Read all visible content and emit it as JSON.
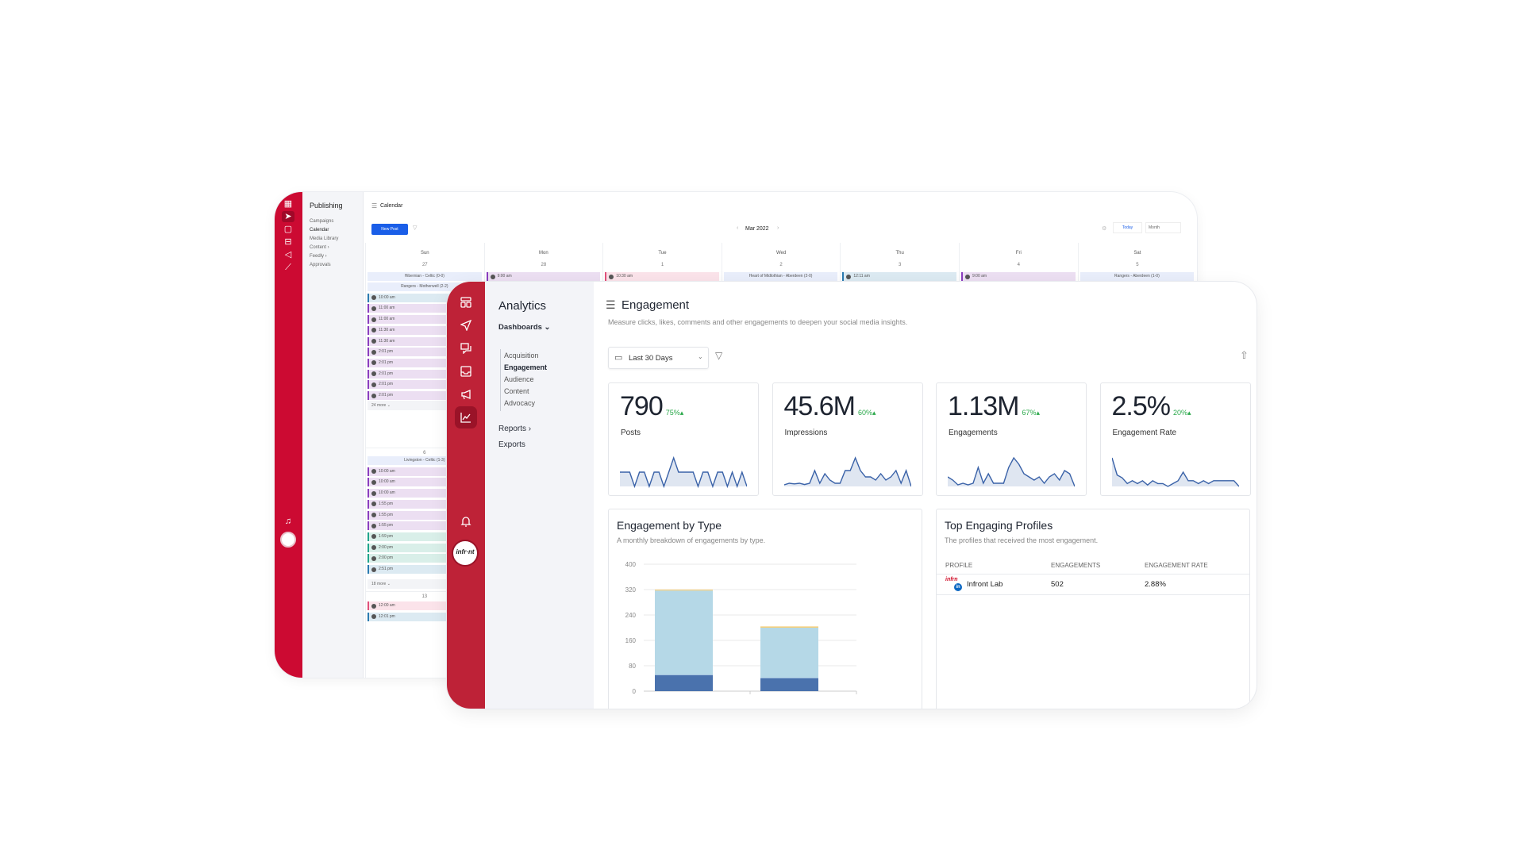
{
  "publishing": {
    "title": "Publishing",
    "items": [
      "Campaigns",
      "Calendar",
      "Media Library",
      "Content ›",
      "Feedly ›",
      "Approvals"
    ],
    "calendar_title": "Calendar",
    "new_post": "New Post",
    "month": "Mar 2022",
    "today": "Today",
    "view": "Month",
    "days": [
      "Sun",
      "Mon",
      "Tue",
      "Wed",
      "Thu",
      "Fri",
      "Sat"
    ],
    "week1_dates": [
      "27",
      "28",
      "1",
      "2",
      "3",
      "4",
      "5"
    ],
    "week1_events": [
      {
        "day": 0,
        "text": "Hibernian - Celtic (0-0)",
        "kind": "g"
      },
      {
        "day": 1,
        "text": "9:00 am",
        "kind": "v"
      },
      {
        "day": 2,
        "text": "10:30 am",
        "kind": "p"
      },
      {
        "day": 3,
        "text": "Heart of Midlothian - Aberdeen (2-0)",
        "kind": "g"
      },
      {
        "day": 4,
        "text": "12:11 am",
        "kind": "b"
      },
      {
        "day": 5,
        "text": "9:00 am",
        "kind": "v"
      },
      {
        "day": 6,
        "text": "Rangers - Aberdeen (1-0)",
        "kind": "g"
      }
    ],
    "sun_events_1": [
      {
        "text": "Rangers - Motherwell (2-2)",
        "kind": "g"
      },
      {
        "text": "10:00 am",
        "kind": "b"
      },
      {
        "text": "11:00 am",
        "kind": "v"
      },
      {
        "text": "11:00 am",
        "kind": "v"
      },
      {
        "text": "11:30 am",
        "kind": "v"
      },
      {
        "text": "11:30 am",
        "kind": "v"
      },
      {
        "text": "2:01 pm",
        "kind": "v"
      },
      {
        "text": "2:01 pm",
        "kind": "v"
      },
      {
        "text": "2:01 pm",
        "kind": "v"
      },
      {
        "text": "2:01 pm",
        "kind": "v"
      },
      {
        "text": "2:01 pm",
        "kind": "v"
      }
    ],
    "more_1": "24 more ⌄",
    "date_6": "6",
    "sun_events_2": [
      {
        "text": "Livingston - Celtic (1-3)",
        "kind": "g"
      },
      {
        "text": "10:00 am",
        "kind": "v"
      },
      {
        "text": "10:00 am",
        "kind": "v"
      },
      {
        "text": "10:00 am",
        "kind": "v"
      },
      {
        "text": "1:55 pm",
        "kind": "v"
      },
      {
        "text": "1:55 pm",
        "kind": "v"
      },
      {
        "text": "1:55 pm",
        "kind": "v"
      },
      {
        "text": "1:59 pm",
        "kind": "t"
      },
      {
        "text": "2:00 pm",
        "kind": "t"
      },
      {
        "text": "2:00 pm",
        "kind": "t"
      },
      {
        "text": "2:51 pm",
        "kind": "b"
      }
    ],
    "more_2": "18 more ⌄",
    "date_13": "13",
    "sun_events_3": [
      {
        "text": "12:00 am",
        "kind": "p"
      },
      {
        "text": "12:01 pm",
        "kind": "b"
      }
    ]
  },
  "analytics": {
    "title": "Analytics",
    "dashboards": "Dashboards ⌄",
    "sub_items": [
      "Acquisition",
      "Engagement",
      "Audience",
      "Content",
      "Advocacy"
    ],
    "active_sub": "Engagement",
    "reports": "Reports ›",
    "exports": "Exports"
  },
  "main": {
    "title": "Engagement",
    "description": "Measure clicks, likes, comments and other engagements to deepen your social media insights.",
    "date_range": "Last 30 Days",
    "kpis": [
      {
        "value": "790",
        "delta": "75%▴",
        "label": "Posts",
        "trend": [
          3,
          3,
          3,
          0,
          3,
          3,
          0,
          3,
          3,
          0,
          3,
          6,
          3,
          3,
          3,
          3,
          0,
          3,
          3,
          0,
          3,
          3,
          0,
          3,
          0,
          3,
          0
        ]
      },
      {
        "value": "45.6M",
        "delta": "60%▴",
        "label": "Impressions",
        "trend": [
          0.5,
          1,
          0.8,
          1,
          0.6,
          1,
          5,
          1,
          4,
          2,
          1,
          1,
          5,
          5,
          9,
          5,
          3,
          3,
          2,
          4,
          2,
          3,
          5,
          1,
          5,
          0
        ]
      },
      {
        "value": "1.13M",
        "delta": "67%▴",
        "label": "Engagements",
        "trend": [
          3,
          2,
          0.5,
          1,
          0.5,
          1,
          6,
          1,
          4,
          1,
          1,
          1,
          6,
          9,
          7,
          4,
          3,
          2,
          3,
          1,
          3,
          4,
          2,
          5,
          4,
          0
        ]
      },
      {
        "value": "2.5%",
        "delta": "20%▴",
        "label": "Engagement Rate",
        "trend": [
          10,
          4,
          3,
          1,
          2,
          1,
          2,
          0.5,
          2,
          1,
          1,
          0,
          1,
          2,
          5,
          2,
          2,
          1,
          2,
          1,
          2,
          2,
          2,
          2,
          2,
          0
        ]
      }
    ],
    "by_type": {
      "title": "Engagement by Type",
      "subtitle": "A monthly breakdown of engagements by type."
    },
    "profiles": {
      "title": "Top Engaging Profiles",
      "subtitle": "The profiles that received the most engagement.",
      "columns": [
        "PROFILE",
        "ENGAGEMENTS",
        "ENGAGEMENT RATE"
      ],
      "rows": [
        {
          "name": "Infront Lab",
          "engagements": "502",
          "rate": "2.88%"
        }
      ]
    }
  },
  "colors": {
    "brand_red": "#be2237",
    "accent_blue": "#1a5ee8",
    "positive": "#2aa84a",
    "spark": "#3a62a8"
  },
  "chart_data": {
    "type": "bar",
    "stacked": true,
    "categories": [
      "",
      ""
    ],
    "yticks": [
      0,
      80,
      160,
      240,
      320,
      400
    ],
    "ylim": [
      0,
      400
    ],
    "grid": true,
    "series": [
      {
        "values": [
          50,
          40
        ],
        "color": "#4a72ad"
      },
      {
        "values": [
          2,
          3
        ],
        "color": "#8fb3d6"
      },
      {
        "values": [
          265,
          157
        ],
        "color": "#b5d8e7"
      },
      {
        "values": [
          3,
          4
        ],
        "color": "#f6cf78"
      }
    ]
  }
}
